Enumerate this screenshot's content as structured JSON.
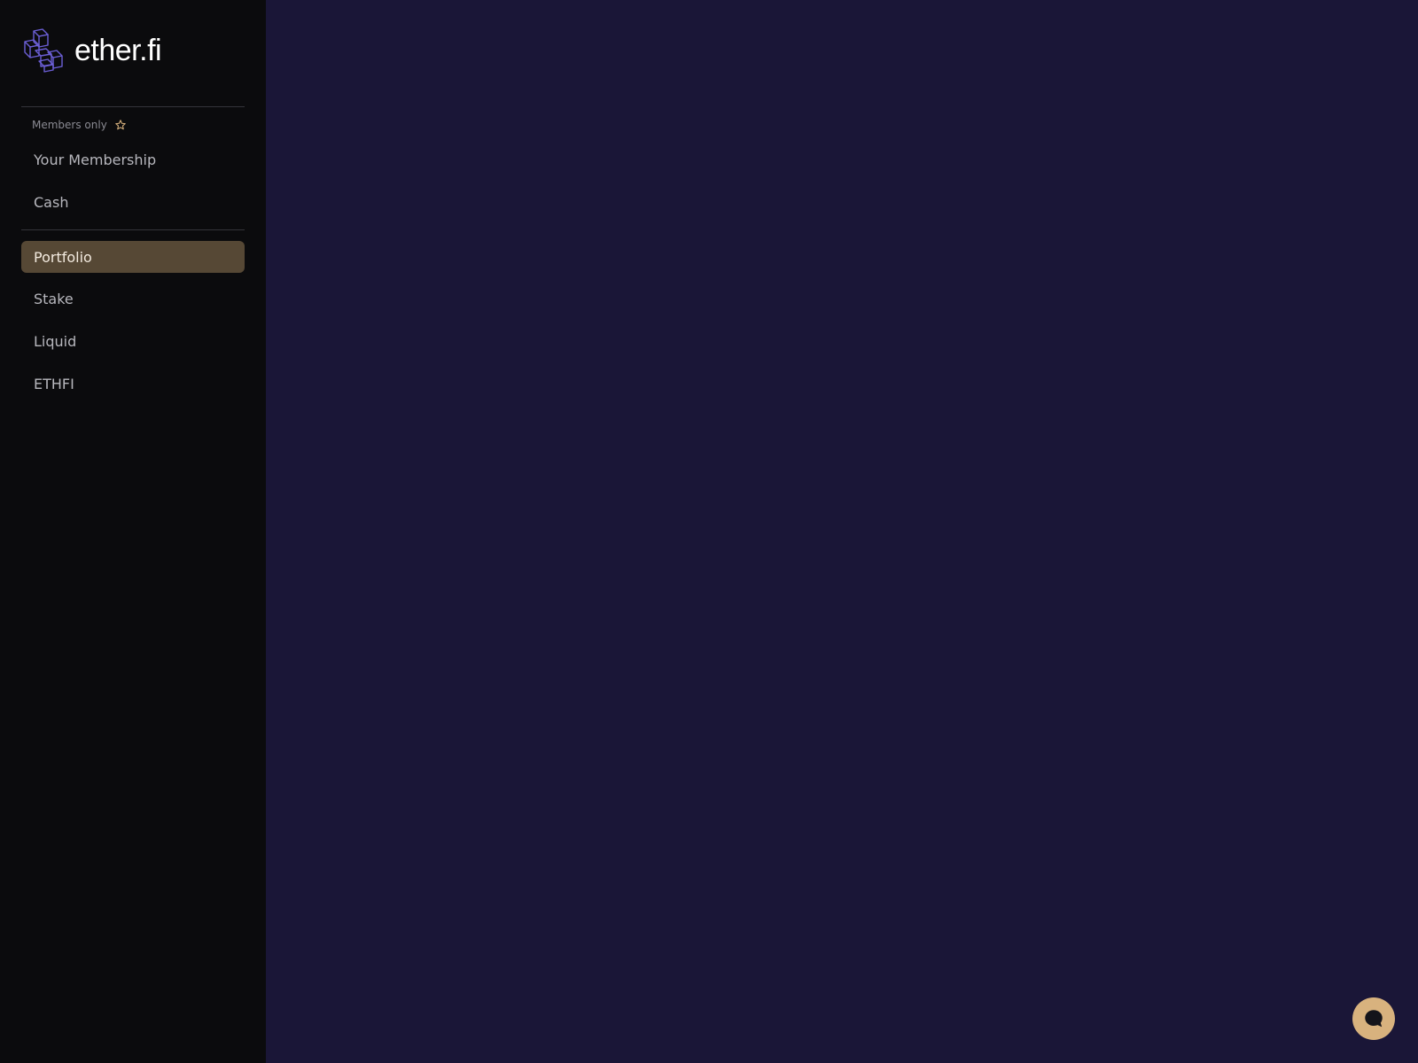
{
  "brand": {
    "name": "ether.fi",
    "logo_icon": "ether-fi-logo-icon",
    "logo_color": "#6c5fd6"
  },
  "sidebar": {
    "members_label": "Members only",
    "members_icon": "star-icon",
    "members_items": [
      {
        "label": "Your Membership"
      },
      {
        "label": "Cash"
      }
    ],
    "nav_items": [
      {
        "label": "Portfolio",
        "active": true
      },
      {
        "label": "Stake",
        "active": false
      },
      {
        "label": "Liquid",
        "active": false
      },
      {
        "label": "ETHFI",
        "active": false
      }
    ]
  },
  "colors": {
    "sidebar_bg": "#0b0b0d",
    "main_bg": "#1a1637",
    "active_item_bg": "#564835",
    "accent": "#d8b27e"
  },
  "chat": {
    "icon": "chat-bubble-icon"
  }
}
